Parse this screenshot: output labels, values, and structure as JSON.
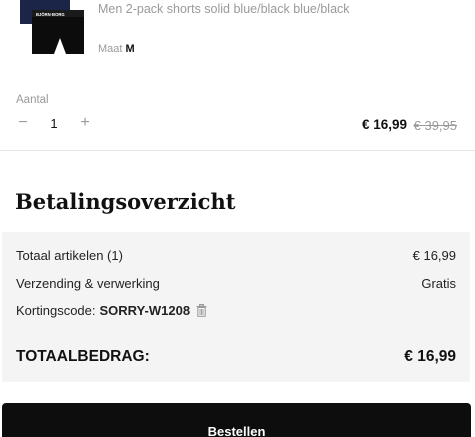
{
  "product": {
    "name": "Men 2-pack shorts solid blue/black blue/black",
    "size_label": "Maat",
    "size_value": "M",
    "image_icon": "boxer-shorts-product-image",
    "colors": {
      "navy": "#1b2547",
      "black": "#0c0c0c"
    }
  },
  "quantity": {
    "label": "Aantal",
    "minus": "−",
    "value": "1",
    "plus": "+"
  },
  "price": {
    "current": "€ 16,99",
    "original": "€ 39,95"
  },
  "summary": {
    "title": "Betalingsoverzicht",
    "items_label": "Totaal artikelen (1)",
    "items_value": "€ 16,99",
    "shipping_label": "Verzending & verwerking",
    "shipping_value": "Gratis",
    "discount_label": "Kortingscode:",
    "discount_code": "SORRY-W1208",
    "discount_remove_icon": "trash-icon",
    "total_label": "TOTAALBEDRAG:",
    "total_value": "€ 16,99"
  },
  "checkout": {
    "button_label": "Bestellen"
  }
}
